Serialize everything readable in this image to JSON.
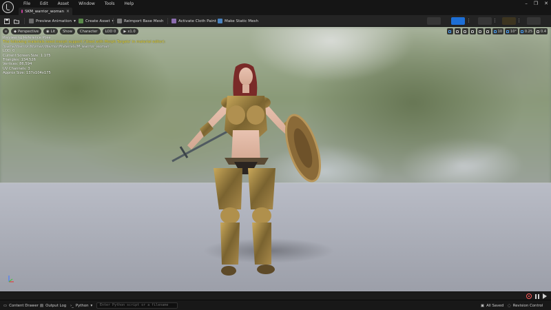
{
  "menu": [
    "File",
    "Edit",
    "Asset",
    "Window",
    "Tools",
    "Help"
  ],
  "tab": {
    "label": "SKM_warrior_woman",
    "close": "×"
  },
  "window_controls": [
    "–",
    "❐",
    "✕"
  ],
  "toolbar": {
    "preview_animation": "Preview Animation",
    "create_asset": "Create Asset",
    "reimport": "Reimport Base Mesh",
    "cloth": "Activate Cloth Paint",
    "static_mesh": "Make Static Mesh"
  },
  "viewport": {
    "buttons": {
      "perspective": "Perspective",
      "lit": "Lit",
      "show": "Show",
      "character": "Character",
      "lod": "LOD 0",
      "speed": "x1.0"
    },
    "right": {
      "grid": "10",
      "angle": "10°",
      "scale": "0.25",
      "cam": "0.4"
    },
    "stats": {
      "line1": "Previewing Reference Pose",
      "line2": "The following materials need morph support ('Used with Morph Targets' in material editor):",
      "line3": "/Game/Warrior/Women/Warrior/Materials/M_warrior_woman",
      "line4": "LOD: 0",
      "line5": "Current Screen Size: 1.175",
      "line6": "Triangles: 134,526",
      "line7": "Vertices: 86,594",
      "line8": "UV Channels: 3",
      "line9": "Approx Size: 137x104x175"
    }
  },
  "status": {
    "content_drawer": "Content Drawer",
    "output_log": "Output Log",
    "python": "Python",
    "python_placeholder": "Enter Python script or a filename",
    "saved": "All Saved",
    "revision": "Revision Control"
  }
}
